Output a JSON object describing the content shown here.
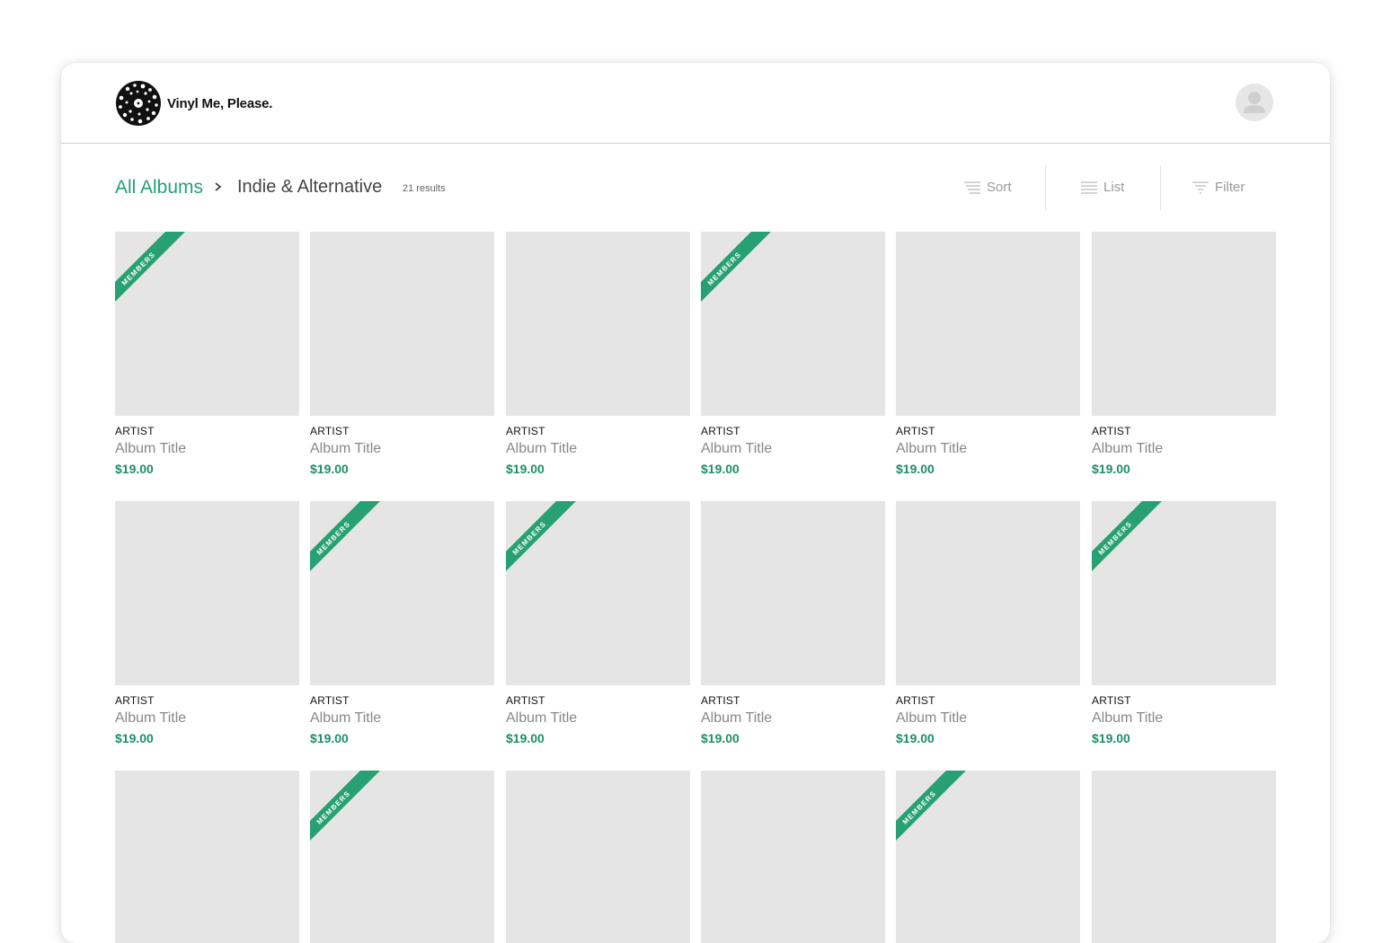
{
  "brand": {
    "name": "Vinyl Me, Please."
  },
  "breadcrumb": {
    "root": "All Albums",
    "current": "Indie & Alternative",
    "results": "21 results"
  },
  "tools": {
    "sort": "Sort",
    "list": "List",
    "filter": "Filter"
  },
  "colors": {
    "accent": "#27a073",
    "price": "#1e8f63",
    "placeholder": "#e5e5e5"
  },
  "badge_label": "MEMBERS",
  "albums": [
    {
      "artist": "ARTIST",
      "title": "Album Title",
      "price": "$19.00",
      "members": true
    },
    {
      "artist": "ARTIST",
      "title": "Album Title",
      "price": "$19.00",
      "members": false
    },
    {
      "artist": "ARTIST",
      "title": "Album Title",
      "price": "$19.00",
      "members": false
    },
    {
      "artist": "ARTIST",
      "title": "Album Title",
      "price": "$19.00",
      "members": true
    },
    {
      "artist": "ARTIST",
      "title": "Album Title",
      "price": "$19.00",
      "members": false
    },
    {
      "artist": "ARTIST",
      "title": "Album Title",
      "price": "$19.00",
      "members": false
    },
    {
      "artist": "ARTIST",
      "title": "Album Title",
      "price": "$19.00",
      "members": false
    },
    {
      "artist": "ARTIST",
      "title": "Album Title",
      "price": "$19.00",
      "members": true
    },
    {
      "artist": "ARTIST",
      "title": "Album Title",
      "price": "$19.00",
      "members": true
    },
    {
      "artist": "ARTIST",
      "title": "Album Title",
      "price": "$19.00",
      "members": false
    },
    {
      "artist": "ARTIST",
      "title": "Album Title",
      "price": "$19.00",
      "members": false
    },
    {
      "artist": "ARTIST",
      "title": "Album Title",
      "price": "$19.00",
      "members": true
    },
    {
      "artist": "",
      "title": "",
      "price": "",
      "members": false
    },
    {
      "artist": "",
      "title": "",
      "price": "",
      "members": true
    },
    {
      "artist": "",
      "title": "",
      "price": "",
      "members": false
    },
    {
      "artist": "",
      "title": "",
      "price": "",
      "members": false
    },
    {
      "artist": "",
      "title": "",
      "price": "",
      "members": true
    },
    {
      "artist": "",
      "title": "",
      "price": "",
      "members": false
    }
  ]
}
